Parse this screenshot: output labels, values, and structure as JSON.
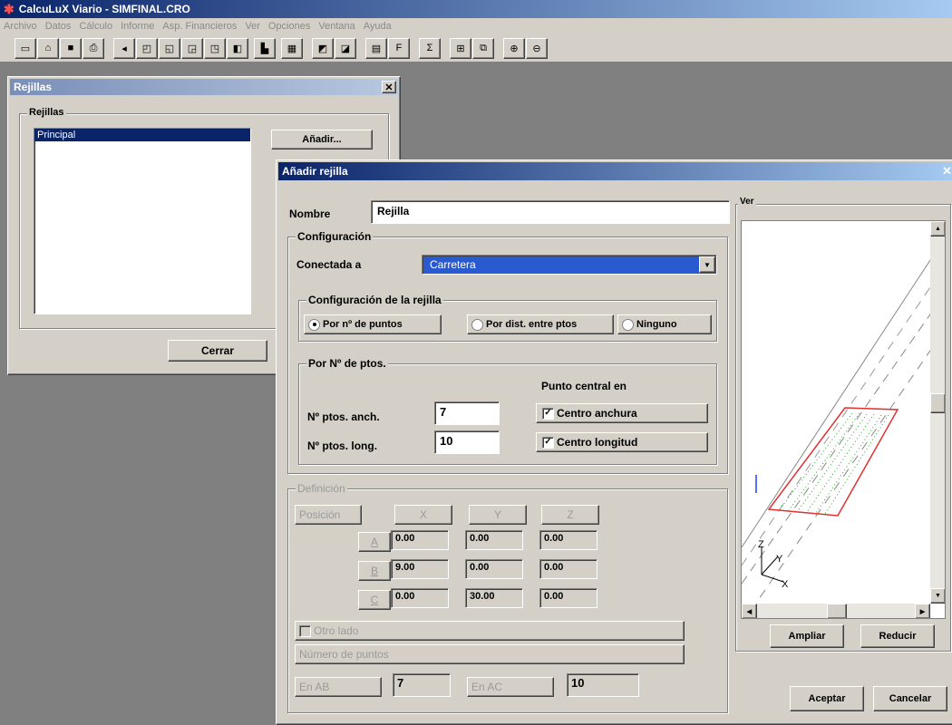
{
  "app": {
    "title": "CalcuLuX Viario - SIMFINAL.CRO",
    "menu": [
      "Archivo",
      "Datos",
      "Cálculo",
      "Informe",
      "Asp. Financieros",
      "Ver",
      "Opciones",
      "Ventana",
      "Ayuda"
    ],
    "toolbar_icons": [
      "new-doc-icon",
      "open-icon",
      "save-icon",
      "print-icon",
      "arrow-left-icon",
      "view1-icon",
      "view2-icon",
      "view3-icon",
      "view4-icon",
      "view5-icon",
      "render-icon",
      "calc-icon",
      "chart1-icon",
      "chart2-icon",
      "grid-icon",
      "fx-icon",
      "sum-icon",
      "tile-icon",
      "cascade-icon",
      "zoom-in-icon",
      "zoom-out-icon"
    ],
    "colors": {
      "titlebar_start": "#0a246a",
      "titlebar_end": "#a6caf0",
      "window_bg": "#d4d0c8",
      "selection": "#0a246a",
      "drawing_red": "#e03030",
      "drawing_green": "#22aa22",
      "drawing_blue": "#2040ff"
    }
  },
  "rejillas": {
    "title": "Rejillas",
    "group_label": "Rejillas",
    "items": [
      "Principal"
    ],
    "add_button": "Añadir...",
    "close_button": "Cerrar"
  },
  "dialog": {
    "title": "Añadir rejilla",
    "nombre_label": "Nombre",
    "nombre_value": "Rejilla",
    "config_group": "Configuración",
    "conectada_label": "Conectada a",
    "conectada_value": "Carretera",
    "config_rejilla_group": "Configuración de la rejilla",
    "radio_puntos": "Por nº de puntos",
    "radio_dist": "Por dist. entre ptos",
    "radio_ninguno": "Ninguno",
    "ptos_group": "Por Nº de ptos.",
    "punto_central": "Punto central en",
    "ptos_anch_label": "Nº ptos. anch.",
    "ptos_anch_value": "7",
    "ptos_long_label": "Nº ptos. long.",
    "ptos_long_value": "10",
    "centro_anchura": "Centro anchura",
    "centro_longitud": "Centro longitud",
    "definicion_group": "Definición",
    "posicion_label": "Posición",
    "col_x": "X",
    "col_y": "Y",
    "col_z": "Z",
    "rows": [
      {
        "label": "A",
        "x": "0.00",
        "y": "0.00",
        "z": "0.00"
      },
      {
        "label": "B",
        "x": "9.00",
        "y": "0.00",
        "z": "0.00"
      },
      {
        "label": "C",
        "x": "0.00",
        "y": "30.00",
        "z": "0.00"
      }
    ],
    "otro_lado": "Otro lado",
    "numero_puntos": "Número de puntos",
    "en_ab_label": "En AB",
    "en_ab_value": "7",
    "en_ac_label": "En AC",
    "en_ac_value": "10",
    "ver_group": "Ver",
    "ampliar": "Ampliar",
    "reducir": "Reducir",
    "aceptar": "Aceptar",
    "cancelar": "Cancelar",
    "axis_z": "Z",
    "axis_y": "Y",
    "axis_x": "X"
  }
}
